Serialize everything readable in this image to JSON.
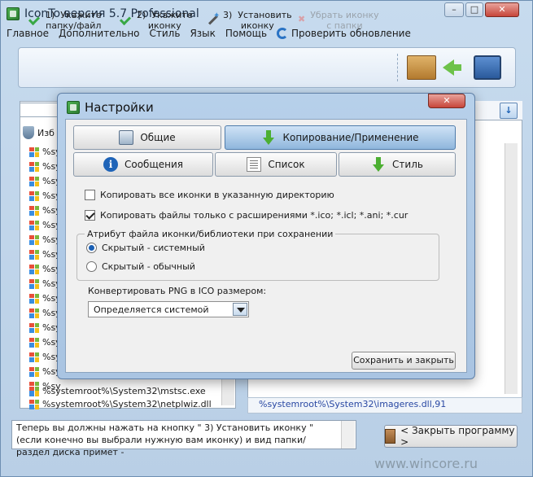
{
  "window": {
    "title": "IconTo версия 5.7 Professional",
    "controls": {
      "minimize": "–",
      "maximize": "□",
      "close": "✕"
    }
  },
  "menu": {
    "items": [
      "Главное",
      "Дополнительно",
      "Стиль",
      "Язык",
      "Помощь"
    ],
    "update": "Проверить обновление"
  },
  "wizard": {
    "step1": "1)  Укажите\nпапку/файл",
    "step2": "2)  Укажите\nиконку",
    "step3": "3)  Установить\nиконку",
    "step4": "Убрать иконку\nс папки"
  },
  "left_list": {
    "header": "Изб",
    "rows": [
      "%sy",
      "%sy",
      "%sy",
      "%sy",
      "%sy",
      "%sy",
      "%sy",
      "%sy",
      "%sy",
      "%sy",
      "%sy",
      "%sy",
      "%sy",
      "%sy",
      "%sy",
      "%sy",
      "%sy"
    ],
    "row_full_1": "%systemroot%\\System32\\mstsc.exe",
    "row_full_2": "%systemroot%\\System32\\netplwiz.dll"
  },
  "right_panel": {
    "download_icon": "↓",
    "path": "%systemroot%\\System32\\imageres.dll,91"
  },
  "hint": {
    "text": "Теперь вы должны нажать на кнопку \" 3)  Установить иконку \" (если конечно вы выбрали нужную вам иконку) и вид папки/раздел диска примет -"
  },
  "close_program": "< Закрыть программу >",
  "watermark": "www.wincore.ru",
  "dialog": {
    "title": "Настройки",
    "close": "✕",
    "tabs": {
      "general": "Общие",
      "copy_apply": "Копирование/Применение",
      "messages": "Сообщения",
      "list": "Список",
      "style": "Стиль"
    },
    "options": {
      "copy_all_icons": "Копировать все иконки в указанную директорию",
      "copy_only_ext": "Копировать файлы только с расширениями *.ico; *.icl; *.ani; *.cur"
    },
    "attr_group": {
      "legend": "Атрибут файла иконки/библиотеки при сохранении",
      "hidden_system": "Скрытый - системный",
      "hidden_normal": "Скрытый - обычный"
    },
    "convert_label": "Конвертировать PNG в ICO размером:",
    "convert_value": "Определяется системой",
    "save_button": "Сохранить и закрыть"
  }
}
